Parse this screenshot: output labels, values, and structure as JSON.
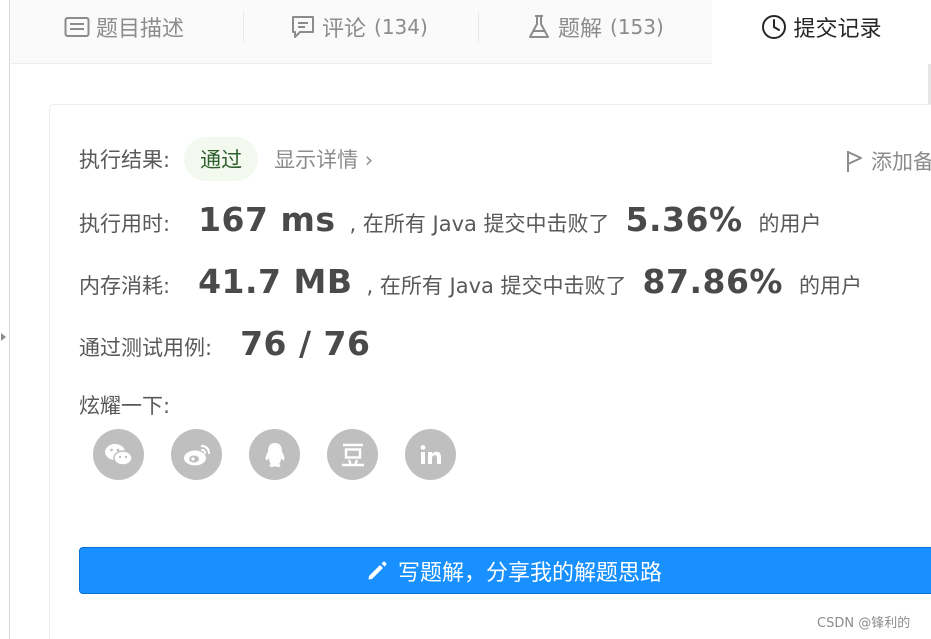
{
  "tabs": [
    {
      "label": "题目描述",
      "count": "",
      "icon": "description-icon",
      "active": false
    },
    {
      "label": "评论",
      "count": "(134)",
      "icon": "comment-icon",
      "active": false
    },
    {
      "label": "题解",
      "count": "(153)",
      "icon": "flask-icon",
      "active": false
    },
    {
      "label": "提交记录",
      "count": "",
      "icon": "clock-icon",
      "active": true
    }
  ],
  "result": {
    "label": "执行结果:",
    "status": "通过",
    "detail_link": "显示详情 ›",
    "add_note": "添加备"
  },
  "runtime": {
    "label": "执行用时:",
    "value": "167 ms",
    "beat_text": ", 在所有 Java 提交中击败了",
    "percent": "5.36%",
    "suffix": "的用户"
  },
  "memory": {
    "label": "内存消耗:",
    "value": "41.7 MB",
    "beat_text": ", 在所有 Java 提交中击败了",
    "percent": "87.86%",
    "suffix": "的用户"
  },
  "tests": {
    "label": "通过测试用例:",
    "value": "76 / 76"
  },
  "share": {
    "label": "炫耀一下:",
    "icons": [
      "wechat-icon",
      "weibo-icon",
      "qq-icon",
      "douban-icon",
      "linkedin-icon"
    ]
  },
  "write_solution": {
    "label": "写题解，分享我的解题思路"
  },
  "watermark": "CSDN @锋利的",
  "colors": {
    "primary": "#1890ff",
    "pass_bg": "#f3f9ef",
    "pass_text": "#2d5f2d",
    "icon_gray": "#bfbfbf"
  }
}
